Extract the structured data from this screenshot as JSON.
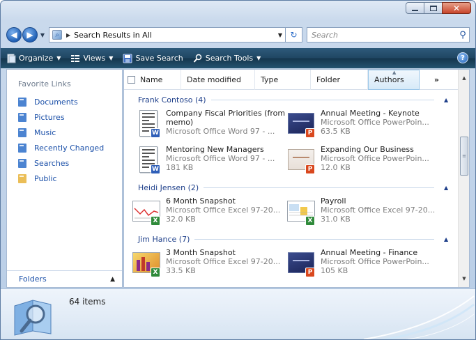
{
  "window": {
    "address_path": "Search Results in All",
    "search_placeholder": "Search"
  },
  "toolbar": {
    "organize": "Organize",
    "views": "Views",
    "save_search": "Save Search",
    "search_tools": "Search Tools",
    "help": "?"
  },
  "nav_pane": {
    "title": "Favorite Links",
    "items": [
      {
        "label": "Documents",
        "icon": "documents-icon",
        "color": "#2d6fc9"
      },
      {
        "label": "Pictures",
        "icon": "pictures-icon",
        "color": "#2d6fc9"
      },
      {
        "label": "Music",
        "icon": "music-icon",
        "color": "#2d6fc9"
      },
      {
        "label": "Recently Changed",
        "icon": "recently-changed-icon",
        "color": "#2d6fc9"
      },
      {
        "label": "Searches",
        "icon": "searches-icon",
        "color": "#2d6fc9"
      },
      {
        "label": "Public",
        "icon": "public-folder-icon",
        "color": "#e8b33a"
      }
    ],
    "folders_label": "Folders"
  },
  "columns": {
    "name": "Name",
    "date_modified": "Date modified",
    "type": "Type",
    "folder": "Folder",
    "authors": "Authors",
    "more": "»"
  },
  "groups": [
    {
      "title": "Frank Contoso (4)",
      "files": [
        {
          "name": "Company Fiscal Priorities (from memo)",
          "type": "Microsoft Office Word 97 - ...",
          "size": "",
          "kind": "word"
        },
        {
          "name": "Annual Meeting - Keynote",
          "type": "Microsoft Office PowerPoin...",
          "size": "63.5 KB",
          "kind": "ppt-dark"
        },
        {
          "name": "Mentoring New Managers",
          "type": "Microsoft Office Word 97 - ...",
          "size": "181 KB",
          "kind": "word"
        },
        {
          "name": "Expanding Our Business",
          "type": "Microsoft Office PowerPoin...",
          "size": "12.0 KB",
          "kind": "ppt-light"
        }
      ]
    },
    {
      "title": "Heidi Jensen (2)",
      "files": [
        {
          "name": "6 Month Snapshot",
          "type": "Microsoft Office Excel 97-20...",
          "size": "32.0 KB",
          "kind": "excel-chart"
        },
        {
          "name": "Payroll",
          "type": "Microsoft Office Excel 97-20...",
          "size": "31.0 KB",
          "kind": "excel-table"
        }
      ]
    },
    {
      "title": "Jim Hance (7)",
      "files": [
        {
          "name": "3 Month Snapshot",
          "type": "Microsoft Office Excel 97-20...",
          "size": "33.5 KB",
          "kind": "excel-bars"
        },
        {
          "name": "Annual Meeting - Finance",
          "type": "Microsoft Office PowerPoin...",
          "size": "105 KB",
          "kind": "ppt-dark"
        }
      ]
    }
  ],
  "details": {
    "count": "64 items"
  },
  "colors": {
    "link": "#1a4fa8",
    "group_header": "#1e3f8a",
    "toolbar_bg": "#1f4662"
  }
}
